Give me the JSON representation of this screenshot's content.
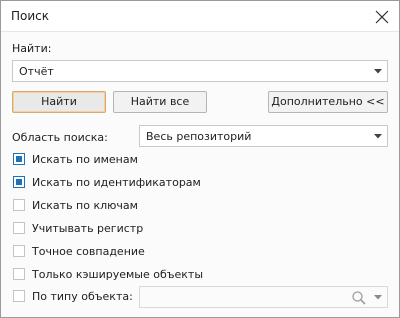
{
  "dialog": {
    "title": "Поиск",
    "close_icon": "close-icon"
  },
  "find": {
    "label": "Найти:",
    "value": "Отчёт",
    "dropdown_icon": "chevron-down-icon"
  },
  "buttons": {
    "find": "Найти",
    "find_all": "Найти все",
    "advanced": "Дополнительно <<"
  },
  "scope": {
    "label": "Область поиска:",
    "value": "Весь репозиторий",
    "dropdown_icon": "chevron-down-icon"
  },
  "options": [
    {
      "label": "Искать по именам",
      "checked": true
    },
    {
      "label": "Искать по идентификаторам",
      "checked": true
    },
    {
      "label": "Искать по ключам",
      "checked": false
    },
    {
      "label": "Учитывать регистр",
      "checked": false
    },
    {
      "label": "Точное совпадение",
      "checked": false
    },
    {
      "label": "Только кэшируемые объекты",
      "checked": false
    }
  ],
  "object_type": {
    "label": "По типу объекта:",
    "checked": false,
    "value": "",
    "search_icon": "search-icon",
    "dropdown_icon": "chevron-down-icon"
  },
  "colors": {
    "accent": "#1f72b8",
    "default_button_border": "#d8a86c"
  }
}
